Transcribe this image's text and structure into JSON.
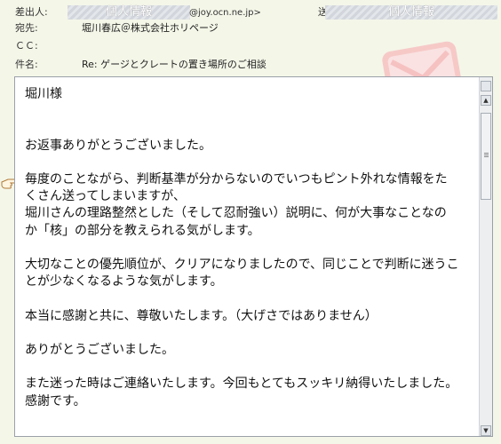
{
  "header": {
    "from_label": "差出人:",
    "from_redacted": "個人情報",
    "from_email_suffix": "@joy.ocn.ne.jp>",
    "to_label_partial": "送",
    "to_redacted": "個人情報",
    "recipient_label": "宛先:",
    "recipient_value": "堀川春広＠株式会社ホリページ",
    "cc_label": "ＣＣ:",
    "cc_value": "",
    "subject_label": "件名:",
    "subject_value": "Re: ゲージとクレートの置き場所のご相談"
  },
  "body": {
    "lines": [
      "堀川様",
      "",
      "",
      "お返事ありがとうございました。",
      "",
      "毎度のことながら、判断基準が分からないのでいつもピント外れな情報をた",
      "くさん送ってしまいますが、",
      "堀川さんの理路整然とした（そして忍耐強い）説明に、何が大事なことなの",
      "か「核」の部分を教えられる気がします。",
      "",
      "大切なことの優先順位が、クリアになりましたので、同じことで判断に迷うこ",
      "とが少なくなるような気がします。",
      "",
      "本当に感謝と共に、尊敬いたします。（大げさではありません）",
      "",
      "ありがとうございました。",
      "",
      "また迷った時はご連絡いたします。今回もとてもスッキリ納得いたしました。",
      "感謝です。"
    ]
  },
  "icons": {
    "envelope": "envelope-icon",
    "pointer": "pointing-hand-icon"
  },
  "colors": {
    "background": "#f4f6e8",
    "envelope": "#f4b7b7"
  }
}
